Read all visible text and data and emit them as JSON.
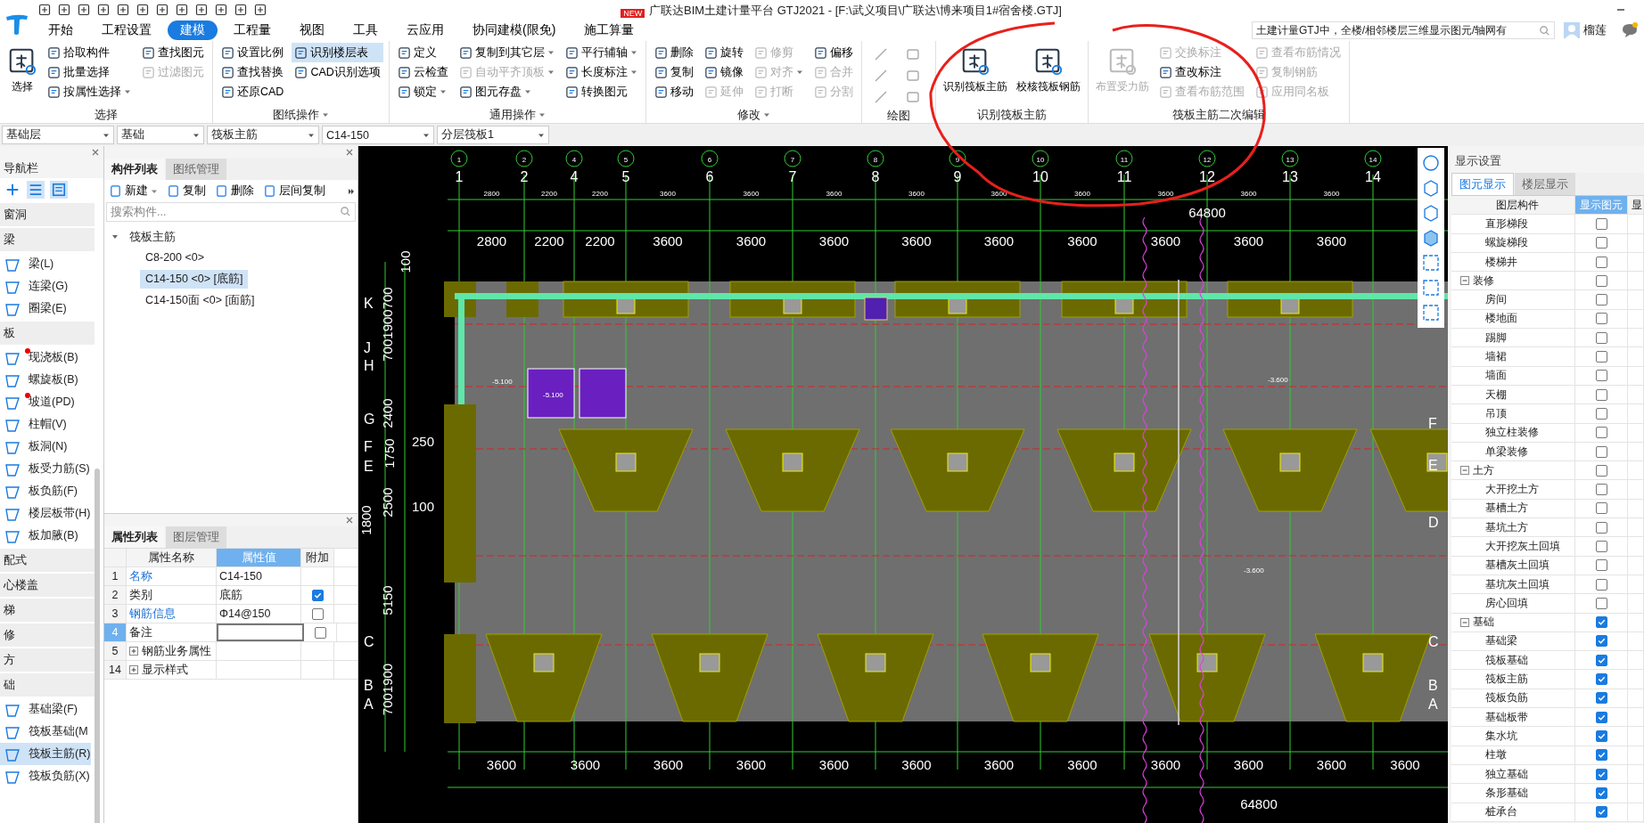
{
  "title_bar": {
    "title": "广联达BIM土建计量平台 GTJ2021 - [F:\\武义项目\\广联达\\博来项目1#宿舍楼.GTJ]",
    "search": "土建计量GTJ中，全楼/相邻楼层三维显示图元/轴网有",
    "user": "榴莲"
  },
  "menu_tabs": [
    {
      "label": "开始",
      "selected": false
    },
    {
      "label": "工程设置",
      "selected": false
    },
    {
      "label": "建模",
      "selected": true
    },
    {
      "label": "工程量",
      "selected": false
    },
    {
      "label": "视图",
      "selected": false
    },
    {
      "label": "工具",
      "selected": false
    },
    {
      "label": "云应用",
      "selected": false
    },
    {
      "label": "协同建模(限免)",
      "selected": false
    },
    {
      "label": "施工算量",
      "selected": false,
      "badge": "NEW"
    }
  ],
  "ribbon_groups": [
    {
      "title": "选择",
      "kind": "buttons",
      "columns": [
        [
          {
            "label": "选择",
            "kind": "large",
            "disabled": false,
            "dropdown": false,
            "on": false
          }
        ],
        [
          {
            "label": "拾取构件",
            "kind": "small",
            "disabled": false,
            "dropdown": false,
            "on": false
          },
          {
            "label": "批量选择",
            "kind": "small",
            "disabled": false,
            "dropdown": false,
            "on": false
          },
          {
            "label": "按属性选择",
            "kind": "small",
            "disabled": false,
            "dropdown": true,
            "on": false
          }
        ],
        [
          {
            "label": "查找图元",
            "kind": "small",
            "disabled": false,
            "dropdown": false,
            "on": false
          },
          {
            "label": "过滤图元",
            "kind": "small",
            "disabled": true,
            "dropdown": false,
            "on": false
          }
        ]
      ]
    },
    {
      "title": "图纸操作",
      "kind": "buttons",
      "dropdown": true,
      "columns": [
        [
          {
            "label": "设置比例",
            "kind": "small",
            "disabled": false,
            "dropdown": false,
            "on": false
          },
          {
            "label": "查找替换",
            "kind": "small",
            "disabled": false,
            "dropdown": false,
            "on": false
          },
          {
            "label": "还原CAD",
            "kind": "small",
            "disabled": false,
            "dropdown": false,
            "on": false
          }
        ],
        [
          {
            "label": "识别楼层表",
            "kind": "small",
            "disabled": false,
            "dropdown": false,
            "on": true
          },
          {
            "label": "CAD识别选项",
            "kind": "small",
            "disabled": false,
            "dropdown": false,
            "on": false
          }
        ]
      ]
    },
    {
      "title": "通用操作",
      "kind": "buttons",
      "dropdown": true,
      "columns": [
        [
          {
            "label": "定义",
            "kind": "small",
            "disabled": false,
            "dropdown": false,
            "on": false
          },
          {
            "label": "云检查",
            "kind": "small",
            "disabled": false,
            "dropdown": false,
            "on": false
          },
          {
            "label": "锁定",
            "kind": "small",
            "disabled": false,
            "dropdown": true,
            "on": false
          }
        ],
        [
          {
            "label": "复制到其它层",
            "kind": "small",
            "disabled": false,
            "dropdown": true,
            "on": false
          },
          {
            "label": "自动平齐顶板",
            "kind": "small",
            "disabled": true,
            "dropdown": true,
            "on": false
          },
          {
            "label": "图元存盘",
            "kind": "small",
            "disabled": false,
            "dropdown": true,
            "on": false
          }
        ],
        [
          {
            "label": "平行辅轴",
            "kind": "small",
            "disabled": false,
            "dropdown": true,
            "on": false
          },
          {
            "label": "长度标注",
            "kind": "small",
            "disabled": false,
            "dropdown": true,
            "on": false
          },
          {
            "label": "转换图元",
            "kind": "small",
            "disabled": false,
            "dropdown": false,
            "on": false
          }
        ]
      ]
    },
    {
      "title": "修改",
      "kind": "buttons",
      "dropdown": true,
      "columns": [
        [
          {
            "label": "删除",
            "kind": "small",
            "disabled": false,
            "dropdown": false,
            "on": false
          },
          {
            "label": "复制",
            "kind": "small",
            "disabled": false,
            "dropdown": false,
            "on": false
          },
          {
            "label": "移动",
            "kind": "small",
            "disabled": false,
            "dropdown": false,
            "on": false
          }
        ],
        [
          {
            "label": "旋转",
            "kind": "small",
            "disabled": false,
            "dropdown": false,
            "on": false
          },
          {
            "label": "镜像",
            "kind": "small",
            "disabled": false,
            "dropdown": false,
            "on": false
          },
          {
            "label": "延伸",
            "kind": "small",
            "disabled": true,
            "dropdown": false,
            "on": false
          }
        ],
        [
          {
            "label": "修剪",
            "kind": "small",
            "disabled": true,
            "dropdown": false,
            "on": false
          },
          {
            "label": "对齐",
            "kind": "small",
            "disabled": true,
            "dropdown": true,
            "on": false
          },
          {
            "label": "打断",
            "kind": "small",
            "disabled": true,
            "dropdown": false,
            "on": false
          }
        ],
        [
          {
            "label": "偏移",
            "kind": "small",
            "disabled": false,
            "dropdown": false,
            "on": false
          },
          {
            "label": "合并",
            "kind": "small",
            "disabled": true,
            "dropdown": false,
            "on": false
          },
          {
            "label": "分割",
            "kind": "small",
            "disabled": true,
            "dropdown": false,
            "on": false
          }
        ]
      ]
    },
    {
      "title": "绘图",
      "kind": "draw"
    },
    {
      "title": "识别筏板主筋",
      "kind": "buttons",
      "columns": [
        [
          {
            "label": "识别筏板主筋",
            "kind": "large",
            "disabled": false,
            "dropdown": false,
            "on": false
          }
        ],
        [
          {
            "label": "校核筏板钢筋",
            "kind": "large",
            "disabled": false,
            "dropdown": false,
            "on": false
          }
        ]
      ]
    },
    {
      "title": "筏板主筋二次编辑",
      "kind": "buttons",
      "columns": [
        [
          {
            "label": "布置受力筋",
            "kind": "large",
            "disabled": true,
            "dropdown": false,
            "on": false
          }
        ],
        [
          {
            "label": "交换标注",
            "kind": "small",
            "disabled": true,
            "dropdown": false,
            "on": false
          },
          {
            "label": "查改标注",
            "kind": "small",
            "disabled": false,
            "dropdown": false,
            "on": false
          },
          {
            "label": "查看布筋范围",
            "kind": "small",
            "disabled": true,
            "dropdown": false,
            "on": false
          }
        ],
        [
          {
            "label": "查看布筋情况",
            "kind": "small",
            "disabled": true,
            "dropdown": false,
            "on": false
          },
          {
            "label": "复制钢筋",
            "kind": "small",
            "disabled": true,
            "dropdown": false,
            "on": false
          },
          {
            "label": "应用同名板",
            "kind": "small",
            "disabled": true,
            "dropdown": false,
            "on": false
          }
        ]
      ]
    }
  ],
  "selectors": [
    "基础层",
    "基础",
    "筏板主筋",
    "C14-150",
    "分层筏板1"
  ],
  "nav": {
    "title": "导航栏",
    "categories": [
      {
        "label": "窗洞"
      },
      {
        "label": "梁",
        "items": [
          {
            "label": "梁(L)",
            "marked": false,
            "selected": false
          },
          {
            "label": "连梁(G)",
            "marked": false,
            "selected": false
          },
          {
            "label": "圈梁(E)",
            "marked": false,
            "selected": false
          }
        ]
      },
      {
        "label": "板",
        "items": [
          {
            "label": "现浇板(B)",
            "marked": true,
            "selected": false
          },
          {
            "label": "螺旋板(B)",
            "marked": false,
            "selected": false
          },
          {
            "label": "坡道(PD)",
            "marked": true,
            "selected": false
          },
          {
            "label": "柱帽(V)",
            "marked": false,
            "selected": false
          },
          {
            "label": "板洞(N)",
            "marked": false,
            "selected": false
          },
          {
            "label": "板受力筋(S)",
            "marked": false,
            "selected": false
          },
          {
            "label": "板负筋(F)",
            "marked": false,
            "selected": false
          },
          {
            "label": "楼层板带(H)",
            "marked": false,
            "selected": false
          },
          {
            "label": "板加腋(B)",
            "marked": false,
            "selected": false
          }
        ]
      },
      {
        "label": "配式"
      },
      {
        "label": "心楼盖"
      },
      {
        "label": "梯"
      },
      {
        "label": "修"
      },
      {
        "label": "方"
      },
      {
        "label": "础",
        "items": [
          {
            "label": "基础梁(F)",
            "marked": false,
            "selected": false
          },
          {
            "label": "筏板基础(M",
            "marked": false,
            "selected": false
          },
          {
            "label": "筏板主筋(R)",
            "marked": false,
            "selected": true
          },
          {
            "label": "筏板负筋(X)",
            "marked": false,
            "selected": false
          }
        ]
      }
    ]
  },
  "component_panel": {
    "tabs": [
      {
        "label": "构件列表",
        "selected": true
      },
      {
        "label": "图纸管理",
        "selected": false
      }
    ],
    "toolbar": [
      {
        "label": "新建",
        "dropdown": true
      },
      {
        "label": "复制",
        "dropdown": false
      },
      {
        "label": "删除",
        "dropdown": false
      },
      {
        "label": "层间复制",
        "dropdown": false
      }
    ],
    "search": {
      "placeholder": "搜索构件..."
    },
    "tree": [
      {
        "label": "筏板主筋",
        "expanded": true,
        "selected": false,
        "children": [
          {
            "label": "C8-200 <0>",
            "selected": false
          },
          {
            "label": "C14-150 <0> [底筋]",
            "selected": true
          },
          {
            "label": "C14-150面 <0> [面筋]",
            "selected": false
          }
        ]
      }
    ]
  },
  "property_panel": {
    "tabs": [
      {
        "label": "属性列表",
        "selected": true
      },
      {
        "label": "图层管理",
        "selected": false
      }
    ],
    "columns": [
      "属性名称",
      "属性值",
      "附加"
    ],
    "rows": [
      {
        "num": "1",
        "name": "名称",
        "value": "C14-150",
        "link": true,
        "kind": "plain",
        "current": false
      },
      {
        "num": "2",
        "name": "类别",
        "value": "底筋",
        "link": false,
        "kind": "check",
        "checked": true,
        "current": false
      },
      {
        "num": "3",
        "name": "钢筋信息",
        "value": "Φ14@150",
        "link": true,
        "kind": "check",
        "checked": false,
        "current": false
      },
      {
        "num": "4",
        "name": "备注",
        "link": false,
        "kind": "check",
        "checked": false,
        "current": true
      },
      {
        "num": "5",
        "name": "钢筋业务属性",
        "link": false,
        "kind": "group",
        "current": false
      },
      {
        "num": "14",
        "name": "显示样式",
        "link": false,
        "kind": "group",
        "current": false
      }
    ]
  },
  "display_panel": {
    "title": "显示设置",
    "tabs": [
      {
        "label": "图元显示",
        "selected": true
      },
      {
        "label": "楼层显示",
        "selected": false
      }
    ],
    "columns": [
      "图层构件",
      "显示图元",
      "显"
    ],
    "rows": [
      {
        "label": "直形梯段",
        "kind": "leaf",
        "checked": false
      },
      {
        "label": "螺旋梯段",
        "kind": "leaf",
        "checked": false
      },
      {
        "label": "楼梯井",
        "kind": "leaf",
        "checked": false
      },
      {
        "label": "装修",
        "kind": "group",
        "checked": false,
        "expanded": true,
        "children": [
          {
            "label": "房间",
            "checked": false
          },
          {
            "label": "楼地面",
            "checked": false
          },
          {
            "label": "踢脚",
            "checked": false
          },
          {
            "label": "墙裙",
            "checked": false
          },
          {
            "label": "墙面",
            "checked": false
          },
          {
            "label": "天棚",
            "checked": false
          },
          {
            "label": "吊顶",
            "checked": false
          },
          {
            "label": "独立柱装修",
            "checked": false
          },
          {
            "label": "单梁装修",
            "checked": false
          }
        ]
      },
      {
        "label": "土方",
        "kind": "group",
        "checked": false,
        "expanded": true,
        "children": [
          {
            "label": "大开挖土方",
            "checked": false
          },
          {
            "label": "基槽土方",
            "checked": false
          },
          {
            "label": "基坑土方",
            "checked": false
          },
          {
            "label": "大开挖灰土回填",
            "checked": false
          },
          {
            "label": "基槽灰土回填",
            "checked": false
          },
          {
            "label": "基坑灰土回填",
            "checked": false
          },
          {
            "label": "房心回填",
            "checked": false
          }
        ]
      },
      {
        "label": "基础",
        "kind": "group",
        "checked": true,
        "expanded": true,
        "children": [
          {
            "label": "基础梁",
            "checked": true
          },
          {
            "label": "筏板基础",
            "checked": true
          },
          {
            "label": "筏板主筋",
            "checked": true
          },
          {
            "label": "筏板负筋",
            "checked": true
          },
          {
            "label": "基础板带",
            "checked": true
          },
          {
            "label": "集水坑",
            "checked": true
          },
          {
            "label": "柱墩",
            "checked": true
          },
          {
            "label": "独立基础",
            "checked": true
          },
          {
            "label": "条形基础",
            "checked": true
          },
          {
            "label": "桩承台",
            "checked": true
          }
        ]
      }
    ]
  },
  "canvas": {
    "top_axis_bubbles": [
      "1",
      "2",
      "4",
      "5",
      "6",
      "7",
      "8",
      "9",
      "10",
      "11",
      "12",
      "13",
      "14"
    ],
    "top_axes": [
      "1",
      "2",
      "4",
      "5",
      "6",
      "7",
      "8",
      "9",
      "10",
      "11",
      "12",
      "13",
      "14"
    ],
    "top_dims_small": [
      "2800",
      "2200",
      "2200",
      "3600",
      "3600",
      "3600",
      "3600",
      "3600",
      "3600",
      "3600",
      "3600",
      "3600"
    ],
    "top_dims": [
      "2800",
      "2200",
      "2200",
      "3600",
      "3600",
      "3600",
      "3600",
      "3600",
      "3600",
      "3600",
      "3600",
      "3600"
    ],
    "top_total": "64800",
    "bottom_dims": [
      "3600",
      "3600",
      "3600",
      "3600",
      "3600",
      "3600",
      "3600",
      "3600",
      "3600",
      "3600",
      "3600",
      "3600"
    ],
    "bottom_total": "64800",
    "left_rows": [
      "K",
      "J",
      "H",
      "G",
      "F",
      "E",
      "C",
      "B",
      "A"
    ],
    "right_rows": [
      "F",
      "E",
      "D",
      "C",
      "B",
      "A"
    ],
    "left_dims": [
      "100",
      "7001900700",
      "2400",
      "1750",
      "2500",
      "1800",
      "5150",
      "7001900"
    ],
    "left_marks": [
      "250",
      "100"
    ],
    "elevations": [
      "-5.100",
      "-5.100",
      "-3.600",
      "-3.600"
    ]
  }
}
